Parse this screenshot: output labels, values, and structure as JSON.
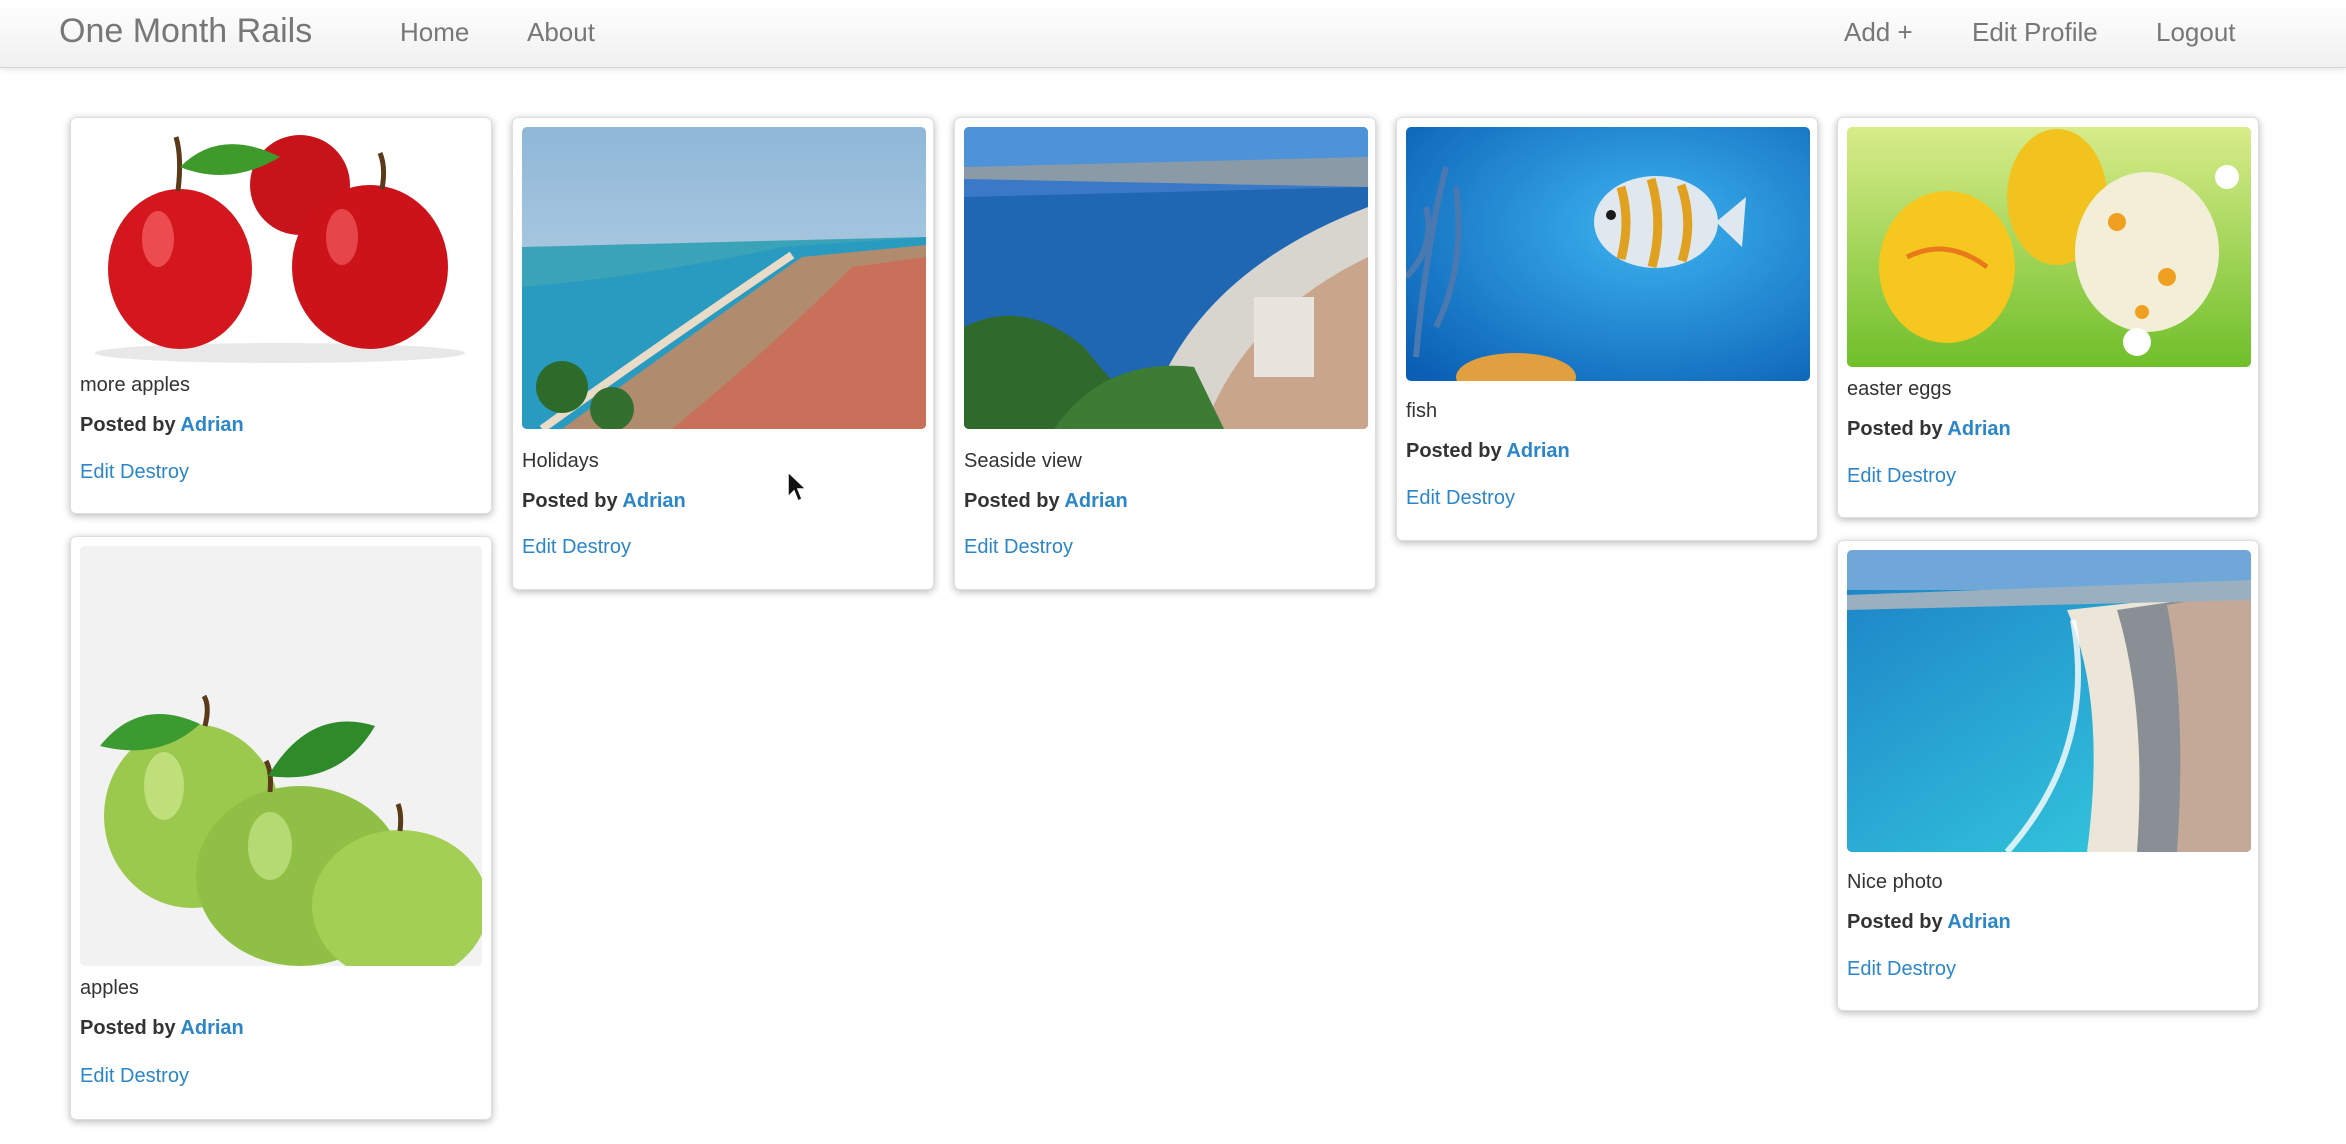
{
  "app": {
    "brand": "One Month Rails",
    "nav_left": [
      {
        "label": "Home"
      },
      {
        "label": "About"
      }
    ],
    "nav_right": [
      {
        "label": "Add +"
      },
      {
        "label": "Edit Profile"
      },
      {
        "label": "Logout"
      }
    ],
    "link_color": "#2a86c9"
  },
  "pins": [
    {
      "caption": "more apples",
      "posted_prefix": "Posted by",
      "author": "Adrian",
      "edit": "Edit",
      "destroy": "Destroy",
      "image": "red-apples"
    },
    {
      "caption": "apples",
      "posted_prefix": "Posted by",
      "author": "Adrian",
      "edit": "Edit",
      "destroy": "Destroy",
      "image": "green-apples"
    },
    {
      "caption": "Holidays",
      "posted_prefix": "Posted by",
      "author": "Adrian",
      "edit": "Edit",
      "destroy": "Destroy",
      "image": "coastal-city"
    },
    {
      "caption": "Seaside view",
      "posted_prefix": "Posted by",
      "author": "Adrian",
      "edit": "Edit",
      "destroy": "Destroy",
      "image": "seaside-town"
    },
    {
      "caption": "fish",
      "posted_prefix": "Posted by",
      "author": "Adrian",
      "edit": "Edit",
      "destroy": "Destroy",
      "image": "tropical-fish"
    },
    {
      "caption": "easter eggs",
      "posted_prefix": "Posted by",
      "author": "Adrian",
      "edit": "Edit",
      "destroy": "Destroy",
      "image": "easter-eggs"
    },
    {
      "caption": "Nice photo",
      "posted_prefix": "Posted by",
      "author": "Adrian",
      "edit": "Edit",
      "destroy": "Destroy",
      "image": "beach-promenade"
    }
  ]
}
